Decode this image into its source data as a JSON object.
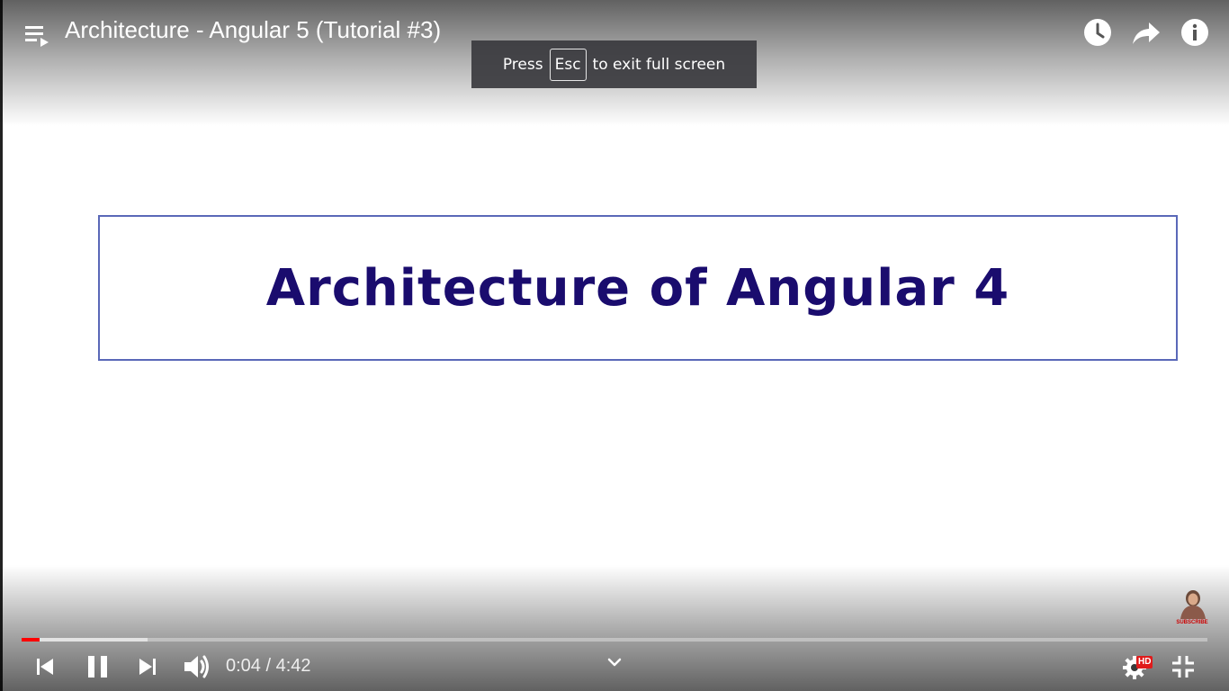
{
  "video": {
    "title": "Architecture - Angular 5 (Tutorial #3)",
    "slide_text": "Architecture of Angular 4",
    "current_time": "0:04",
    "duration": "4:42",
    "time_separator": "/",
    "progress_played_fraction": 0.015,
    "progress_buffered_fraction": 0.106,
    "accent_color": "#ff0000"
  },
  "fullscreen_toast": {
    "press": "Press",
    "key": "Esc",
    "suffix": "to exit full screen"
  },
  "top_bar_icons": [
    "playlist-icon",
    "watch-later-icon",
    "share-icon",
    "info-icon"
  ],
  "controls": {
    "hd_badge": "HD",
    "icons": [
      "previous-icon",
      "pause-icon",
      "next-icon",
      "volume-icon",
      "chevron-down-icon",
      "settings-icon",
      "exit-fullscreen-icon"
    ]
  },
  "watermark": {
    "label": "SUBSCRIBE"
  }
}
